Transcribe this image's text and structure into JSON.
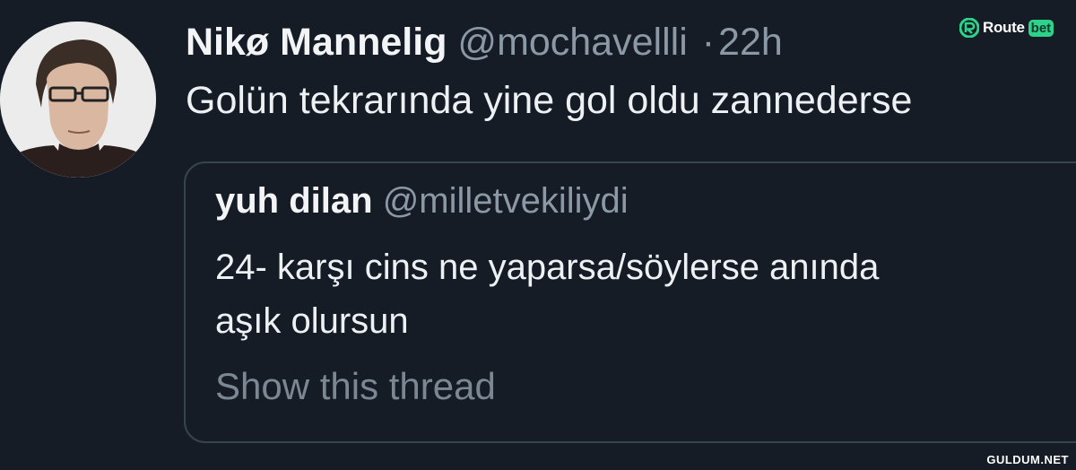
{
  "tweet": {
    "display_name": "Nikø Mannelig",
    "handle": "@mochavellli",
    "separator": "·",
    "time": "22h",
    "text": "Golün tekrarında yine gol oldu zannederse"
  },
  "quoted_tweet": {
    "display_name": "yuh dilan",
    "handle": "@milletvekiliydi",
    "text_lines": [
      "24- karşı cins ne yaparsa/söylerse anında",
      "aşık olursun"
    ],
    "show_thread_label": "Show this thread"
  },
  "brand": {
    "name": "Route",
    "suffix": "bet",
    "accent_color": "#2ed38a"
  },
  "watermark": "GULDUM.NET",
  "colors": {
    "background": "#151c26",
    "muted_text": "#8b98a5",
    "border": "#38444d"
  }
}
